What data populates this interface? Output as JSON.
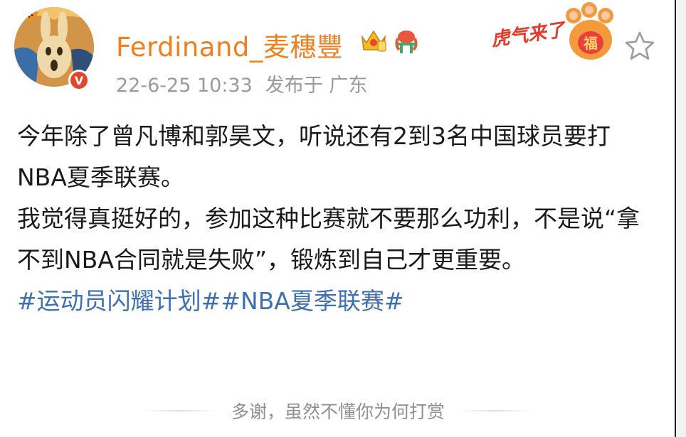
{
  "post": {
    "author": {
      "name": "Ferdinand_麦穗豐",
      "avatar_icon": "scream-rabbit-tiger-avatar",
      "verified_icon": "verified-v-badge",
      "verified_label": "V"
    },
    "meta": {
      "time": "22-6-25 10:33",
      "location": "发布于 广东"
    },
    "badges": [
      "crown-badge-icon",
      "lobster-badge-icon"
    ],
    "decoration": {
      "icon": "tiger-paw-fu-decoration",
      "text": "虎气来了",
      "fu": "福"
    },
    "content": {
      "paragraph1": "今年除了曾凡博和郭昊文，听说还有2到3名中国球员要打NBA夏季联赛。",
      "paragraph2": "我觉得真挺好的，参加这种比赛就不要那么功利，不是说“拿不到NBA合同就是失败”，锻炼到自己才更重要。",
      "tags": [
        "#运动员闪耀计划#",
        "#NBA夏季联赛#"
      ]
    },
    "reward_text": "多谢，虽然不懂你为何打赏"
  },
  "colors": {
    "username": "#f07f1d",
    "meta": "#9a9a9a",
    "tag": "#3e6fb1",
    "body": "#1a1a1a",
    "verified": "#e3462e"
  }
}
